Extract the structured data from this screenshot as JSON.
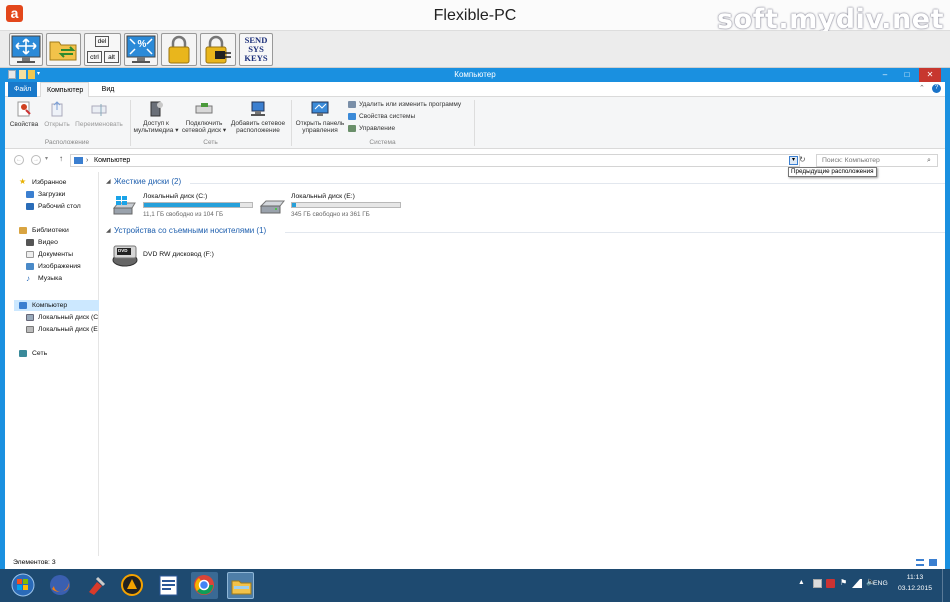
{
  "app": {
    "title": "Flexible-PC",
    "logo_letter": "a",
    "watermark": "soft.mydiv.net"
  },
  "toolbar": {
    "buttons": [
      {
        "name": "fullscreen-monitor-button",
        "icon": "monitor-arrows-icon"
      },
      {
        "name": "file-transfer-button",
        "icon": "folder-arrows-icon"
      },
      {
        "name": "ctrl-alt-del-button",
        "icon": "keyboard-keys-icon",
        "keys": [
          "del",
          "ctrl",
          "alt"
        ]
      },
      {
        "name": "scale-view-button",
        "icon": "monitor-percent-icon",
        "label": "%"
      },
      {
        "name": "lock-button",
        "icon": "lock-icon"
      },
      {
        "name": "lock-input-button",
        "icon": "lock-plug-icon"
      },
      {
        "name": "send-sys-keys-button",
        "label_lines": [
          "SEND",
          "SYS",
          "KEYS"
        ]
      }
    ]
  },
  "window": {
    "title": "Компьютер",
    "controls": {
      "min": "–",
      "max": "□",
      "close": "✕"
    }
  },
  "ribbon": {
    "tabs": [
      {
        "label": "Файл",
        "active": true
      },
      {
        "label": "Компьютер",
        "selected": true
      },
      {
        "label": "Вид"
      }
    ],
    "groups": {
      "location": {
        "label": "Расположение",
        "buttons": [
          {
            "label": "Свойства",
            "enabled": true
          },
          {
            "label": "Открыть",
            "enabled": false
          },
          {
            "label": "Переименовать",
            "enabled": false
          }
        ]
      },
      "network": {
        "label": "Сеть",
        "buttons": [
          {
            "label1": "Доступ к",
            "label2": "мультимедиа ▾"
          },
          {
            "label1": "Подключить",
            "label2": "сетевой диск ▾"
          },
          {
            "label1": "Добавить сетевое",
            "label2": "расположение"
          }
        ]
      },
      "system": {
        "label": "Система",
        "big_button": {
          "label1": "Открыть панель",
          "label2": "управления"
        },
        "small_buttons": [
          "Удалить или изменить программу",
          "Свойства системы",
          "Управление"
        ]
      }
    }
  },
  "address": {
    "breadcrumb": "Компьютер",
    "search_placeholder": "Поиск: Компьютер",
    "tooltip": "Предыдущие расположения"
  },
  "nav": {
    "favorites": {
      "label": "Избранное",
      "items": [
        "Загрузки",
        "Рабочий стол"
      ]
    },
    "libraries": {
      "label": "Библиотеки",
      "items": [
        "Видео",
        "Документы",
        "Изображения",
        "Музыка"
      ]
    },
    "computer": {
      "label": "Компьютер",
      "items": [
        "Локальный диск (C",
        "Локальный диск (E"
      ]
    },
    "network": {
      "label": "Сеть"
    }
  },
  "content": {
    "hdd_header": "Жесткие диски (2)",
    "drives": [
      {
        "name": "Локальный диск (C:)",
        "free": "11,1 ГБ свободно из 104 ГБ",
        "used_fraction": 0.89
      },
      {
        "name": "Локальный диск (E:)",
        "free": "345 ГБ свободно из 361 ГБ",
        "used_fraction": 0.04
      }
    ],
    "removable_header": "Устройства со съемными носителями (1)",
    "dvd": {
      "name": "DVD RW дисковод (F:)",
      "badge": "DVD"
    }
  },
  "status": {
    "items": "Элементов: 3"
  },
  "taskbar": {
    "apps": [
      "start-orb-icon",
      "firefox-icon",
      "tool-icon",
      "aimp-icon",
      "word-icon",
      "chrome-icon",
      "explorer-icon"
    ],
    "tray": {
      "lang": "ENG",
      "time": "11:13",
      "date": "03.12.2015"
    }
  },
  "colors": {
    "accent": "#1a90e0",
    "taskbar": "#1e4a70",
    "bar_fill": "#26a0da",
    "logo": "#e3471b"
  }
}
